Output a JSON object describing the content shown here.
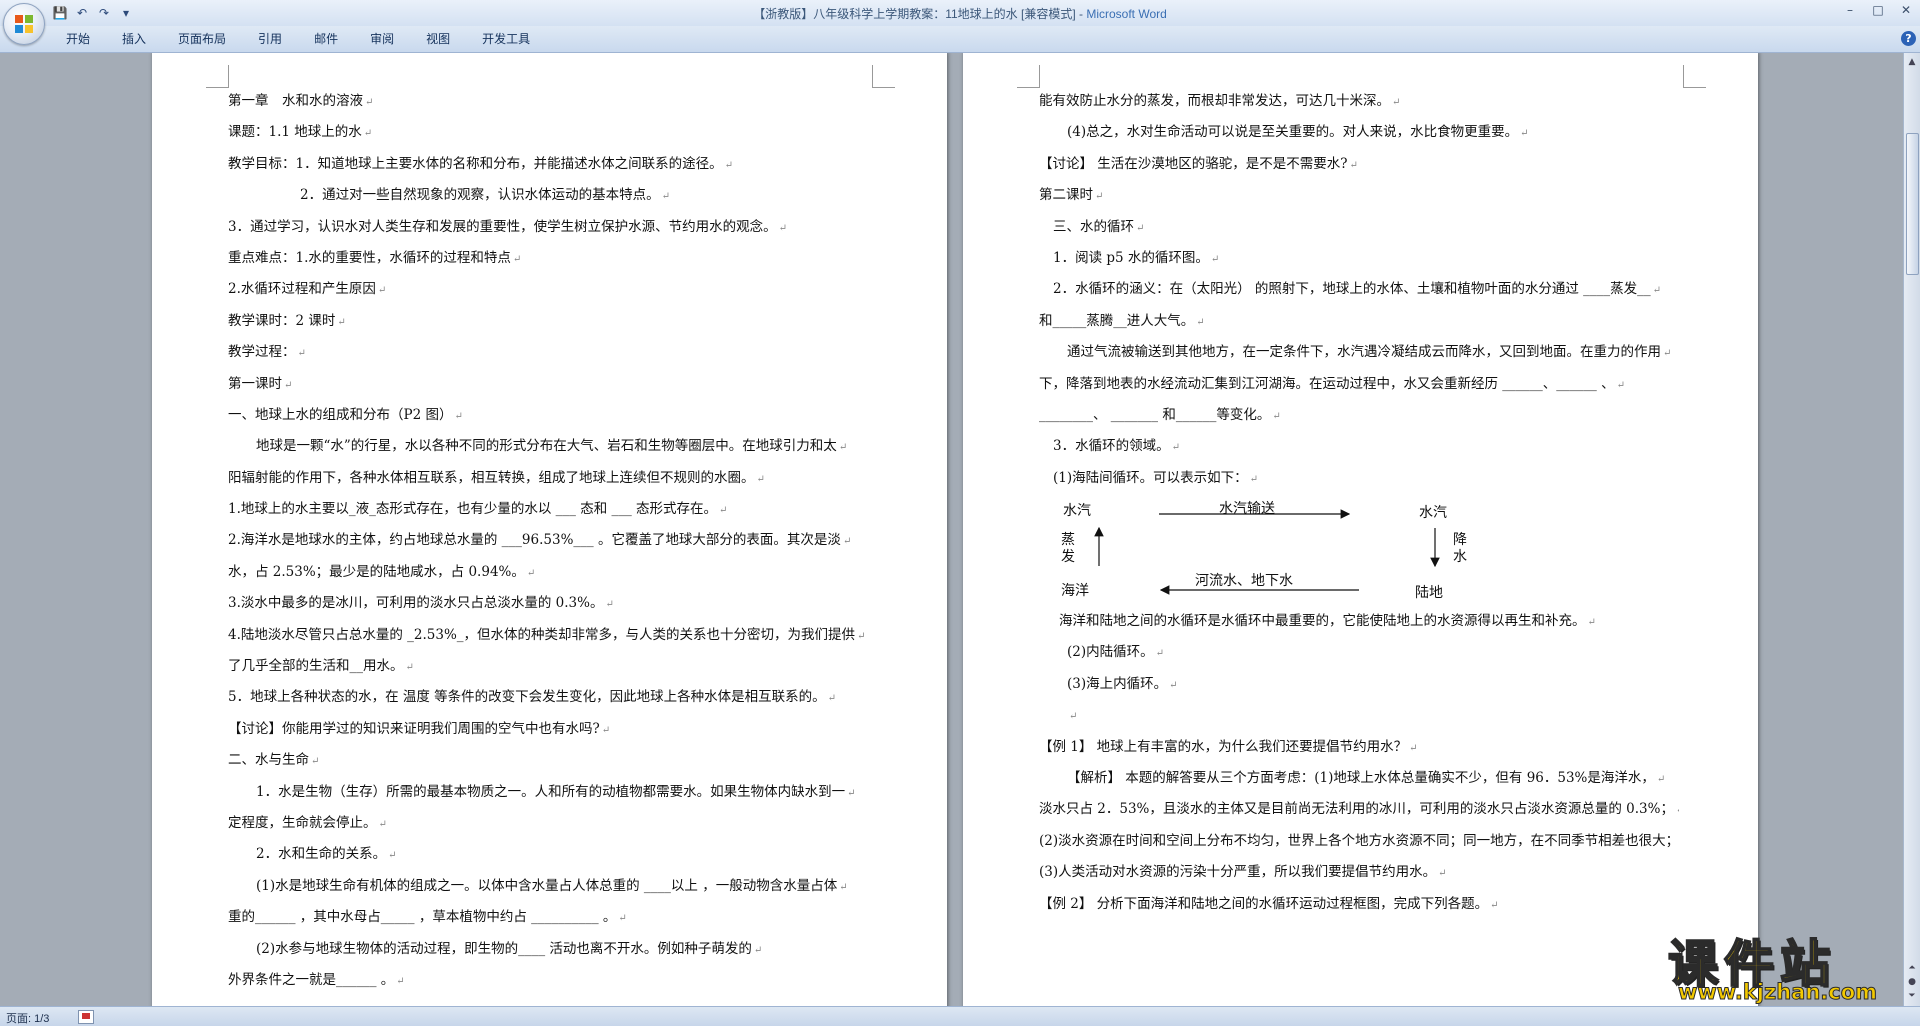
{
  "window": {
    "title": "【浙教版】八年级科学上学期教案：11地球上的水 [兼容模式] - ",
    "app_name": "Microsoft Word",
    "minimize": "–",
    "maximize": "□",
    "close": "✕"
  },
  "quick_access": {
    "save": "💾",
    "undo": "↶",
    "redo": "↷",
    "customize": "▾"
  },
  "ribbon": {
    "tabs": [
      "开始",
      "插入",
      "页面布局",
      "引用",
      "邮件",
      "审阅",
      "视图",
      "开发工具"
    ],
    "help": "?"
  },
  "left_page": {
    "lines": [
      {
        "text": "第一章　水和水的溶液",
        "indent": 0
      },
      {
        "text": "课题：1.1 地球上的水",
        "indent": 0
      },
      {
        "text": "教学目标：1．知道地球上主要水体的名称和分布，并能描述水体之间联系的途径。",
        "indent": 0
      },
      {
        "text": "2．通过对一些自然现象的观察，认识水体运动的基本特点。",
        "indent": 72
      },
      {
        "text": "3．通过学习，认识水对人类生存和发展的重要性，使学生树立保护水源、节约用水的观念。",
        "indent": 0
      },
      {
        "text": "重点难点：1.水的重要性，水循环的过程和特点",
        "indent": 0
      },
      {
        "text": "2.水循环过程和产生原因",
        "indent": 0
      },
      {
        "text": "教学课时：2 课时",
        "indent": 0
      },
      {
        "text": "教学过程：",
        "indent": 0
      },
      {
        "text": "第一课时",
        "indent": 0
      },
      {
        "text": "一、地球上水的组成和分布（P2 图）",
        "indent": 0
      },
      {
        "text": "地球是一颗“水”的行星，水以各种不同的形式分布在大气、岩石和生物等圈层中。在地球引力和太",
        "indent": 28
      },
      {
        "text": "阳辐射能的作用下，各种水体相互联系，相互转换，组成了地球上连续但不规则的水圈。",
        "indent": 0
      },
      {
        "text": "1.地球上的水主要以_液_态形式存在，也有少量的水以 ___ 态和 ___ 态形式存在。",
        "indent": 0
      },
      {
        "text": "2.海洋水是地球水的主体，约占地球总水量的 ___96.53%___ 。它覆盖了地球大部分的表面。其次是淡",
        "indent": 0
      },
      {
        "text": "水，占 2.53%；最少是的陆地咸水，占 0.94%。",
        "indent": 0
      },
      {
        "text": "3.淡水中最多的是冰川，可利用的淡水只占总淡水量的 0.3%。",
        "indent": 0
      },
      {
        "text": "4.陆地淡水尽管只占总水量的 _2.53%_，但水体的种类却非常多，与人类的关系也十分密切，为我们提供",
        "indent": 0
      },
      {
        "text": "了几乎全部的生活和__用水。",
        "indent": 0
      },
      {
        "text": "5．地球上各种状态的水，在 温度 等条件的改变下会发生变化，因此地球上各种水体是相互联系的。",
        "indent": 0
      },
      {
        "text": "【讨论】你能用学过的知识来证明我们周围的空气中也有水吗?",
        "indent": 0
      },
      {
        "text": "二、水与生命",
        "indent": 0
      },
      {
        "text": "1．水是生物（生存）所需的最基本物质之一。人和所有的动植物都需要水。如果生物体内缺水到一",
        "indent": 28
      },
      {
        "text": "定程度，生命就会停止。",
        "indent": 0
      },
      {
        "text": "2．水和生命的关系。",
        "indent": 28
      },
      {
        "text": "(1)水是地球生命有机体的组成之一。以体中含水量占人体总重的 ____以上 ，一般动物含水量占体",
        "indent": 28
      },
      {
        "text": "重的______ ，其中水母占_____ ，草本植物中约占 __________ 。",
        "indent": 0
      },
      {
        "text": "(2)水参与地球生物体的活动过程，即生物的____ 活动也离不开水。例如种子萌发的",
        "indent": 28
      },
      {
        "text": "外界条件之一就是______ 。",
        "indent": 0
      }
    ]
  },
  "right_page": {
    "lines_top": [
      {
        "text": "能有效防止水分的蒸发，而根却非常发达，可达几十米深。",
        "indent": 0
      },
      {
        "text": "(4)总之，水对生命活动可以说是至关重要的。对人来说，水比食物更重要。",
        "indent": 28
      },
      {
        "text": "【讨论】 生活在沙漠地区的骆驼，是不是不需要水?",
        "indent": 0
      },
      {
        "text": "第二课时",
        "indent": 0
      },
      {
        "text": "三、水的循环",
        "indent": 14
      },
      {
        "text": "1．阅读 p5 水的循环图。",
        "indent": 14
      },
      {
        "text": "2．水循环的涵义：在（太阳光） 的照射下，地球上的水体、土壤和植物叶面的水分通过 ____蒸发__",
        "indent": 14
      },
      {
        "text": "和_____蒸腾__进人大气。",
        "indent": 0
      },
      {
        "text": "通过气流被输送到其他地方，在一定条件下，水汽遇冷凝结成云而降水，又回到地面。在重力的作用",
        "indent": 28
      },
      {
        "text": "下，降落到地表的水经流动汇集到江河湖海。在运动过程中，水又会重新经历 ______、______ 、",
        "indent": 0
      },
      {
        "text": "________、 _______ 和______等变化。",
        "indent": 0
      },
      {
        "text": "3．水循环的领域。",
        "indent": 14
      },
      {
        "text": "(1)海陆间循环。可以表示如下：",
        "indent": 14
      }
    ],
    "diagram": {
      "top_left": "水汽",
      "top_right": "水汽",
      "top_arrow": "水汽输送",
      "left_arrow": "蒸发",
      "right_arrow": "降水",
      "bottom_left": "海洋",
      "bottom_right": "陆地",
      "bottom_arrow": "河流水、地下水"
    },
    "lines_bottom": [
      {
        "text": "海洋和陆地之间的水循环是水循环中最重要的，它能使陆地上的水资源得以再生和补充。",
        "indent": 20
      },
      {
        "text": "(2)内陆循环。",
        "indent": 28
      },
      {
        "text": "(3)海上内循环。",
        "indent": 28
      },
      {
        "text": "",
        "indent": 28
      },
      {
        "text": "【例 1】 地球上有丰富的水，为什么我们还要提倡节约用水？",
        "indent": 0
      },
      {
        "text": "【解析】 本题的解答要从三个方面考虑：(1)地球上水体总量确实不少，但有 96．53%是海洋水，",
        "indent": 28
      },
      {
        "text": "淡水只占 2．53%，且淡水的主体又是目前尚无法利用的冰川，可利用的淡水只占淡水资源总量的 0.3%；",
        "indent": 0
      },
      {
        "text": "(2)淡水资源在时间和空间上分布不均匀，世界上各个地方水资源不同；同一地方，在不同季节相差也很大；",
        "indent": 0
      },
      {
        "text": "(3)人类活动对水资源的污染十分严重，所以我们要提倡节约用水。",
        "indent": 0
      },
      {
        "text": "【例 2】 分析下面海洋和陆地之间的水循环运动过程框图，完成下列各题。",
        "indent": 0
      }
    ]
  },
  "status": {
    "page": "页面: 1/3"
  },
  "watermark": {
    "title": "课件站",
    "url": "www.kjzhan.com"
  }
}
